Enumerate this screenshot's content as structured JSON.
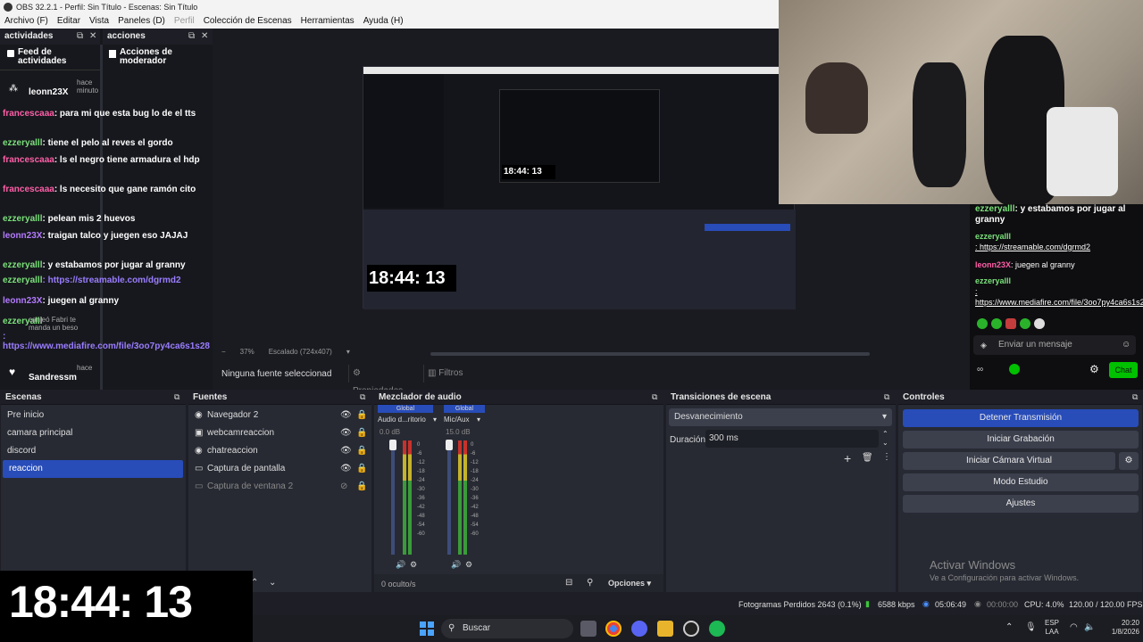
{
  "window": {
    "title": "OBS 32.2.1 - Perfil: Sin Título - Escenas: Sin Título"
  },
  "menu": [
    "Archivo (F)",
    "Editar",
    "Vista",
    "Paneles (D)",
    "Perfil",
    "Colección de Escenas",
    "Herramientas",
    "Ayuda (H)"
  ],
  "docks": {
    "activity": {
      "title": "actividades",
      "feed_label": "Feed de actividades"
    },
    "actions": {
      "title": "acciones",
      "mod_label": "Acciones de moderador"
    }
  },
  "chat_left": {
    "first_user": "leonn23X",
    "first_time": "hace minuto",
    "lines": [
      {
        "user": "francescaaa",
        "text": ": para mi que esta bug lo de el tts"
      },
      {
        "user": "ezzeryalll",
        "text": ": tiene el pelo al reves el gordo"
      },
      {
        "user": "francescaaa",
        "text": ": ls el negro tiene armadura el hdp"
      },
      {
        "user": "francescaaa",
        "text": ": ls necesito que gane ramón cito"
      },
      {
        "user": "ezzeryalll",
        "text": ": pelean mis 2 huevos"
      },
      {
        "user": "leonn23X",
        "text": ": traigan talco y juegen eso JAJAJ"
      },
      {
        "user": "ezzeryalll",
        "text": ": y estabamos por jugar al granny"
      },
      {
        "user": "ezzeryalll",
        "text": ": https://streamable.com/dgrmd2"
      },
      {
        "user": "leonn23X",
        "text": ": juegen al granny"
      },
      {
        "user": "ezzeryalll",
        "text": ": https://www.mediafire.com/file/3oo7py4ca6s1s28"
      }
    ],
    "sub_note": "canjeó Fabri te manda un beso",
    "last_user": "Sandressm",
    "last_time": "hace"
  },
  "preview": {
    "clock_large": "18:44: 13",
    "clock_small": "18:44: 13",
    "zoom": "37%",
    "scale_label": "Escalado (724x407)",
    "no_source": "Ninguna fuente seleccionad",
    "properties_btn": "Propiedades",
    "filters_btn": "Filtros"
  },
  "chat_right": {
    "lines": [
      {
        "user": "ezzeryalll",
        "text": ": y estabamos por jugar al granny"
      },
      {
        "user": "ezzeryalll",
        "text": ": https://streamable.com/dgrmd2"
      },
      {
        "user": "leonn23X",
        "text": ": juegen al granny"
      },
      {
        "user": "ezzeryalll",
        "text": ": https://www.mediafire.com/file/3oo7py4ca6s1s28"
      }
    ],
    "input_placeholder": "Enviar un mensaje",
    "chat_button": "Chat"
  },
  "scenes": {
    "title": "Escenas",
    "items": [
      "Pre inicio",
      "camara principal",
      "discord",
      "reaccion"
    ],
    "selected": "reaccion"
  },
  "sources": {
    "title": "Fuentes",
    "items": [
      "Navegador 2",
      "webcamreaccion",
      "chatreaccion",
      "Captura de pantalla",
      "Captura de ventana 2"
    ]
  },
  "mixer": {
    "title": "Mezclador de audio",
    "channels": [
      {
        "tag": "Global",
        "name": "Audio d...ritorio",
        "db": "0.0 dB"
      },
      {
        "tag": "Global",
        "name": "Mic/Aux",
        "db": "15.0 dB"
      }
    ],
    "scale": [
      "0",
      "-6",
      "-12",
      "-18",
      "-24",
      "-30",
      "-36",
      "-42",
      "-48",
      "-54",
      "-60"
    ],
    "hidden": "0 oculto/s",
    "options": "Opciones"
  },
  "transitions": {
    "title": "Transiciones de escena",
    "selected": "Desvanecimiento",
    "duration_label": "Duración",
    "duration_value": "300 ms"
  },
  "controls": {
    "title": "Controles",
    "buttons": [
      "Detener Transmisión",
      "Iniciar Grabación",
      "Iniciar Cámara Virtual",
      "Modo Estudio",
      "Ajustes"
    ]
  },
  "activate": {
    "title": "Activar Windows",
    "subtitle": "Ve a Configuración para activar Windows."
  },
  "statusbar": {
    "dropped": "Fotogramas Perdidos 2643 (0.1%)",
    "bitrate": "6588 kbps",
    "stream_time": "05:06:49",
    "rec_time": "00:00:00",
    "cpu": "CPU: 4.0%",
    "fps": "120.00 / 120.00 FPS"
  },
  "taskbar": {
    "search": "Buscar",
    "lang": "ESP",
    "lang2": "LAA",
    "time": "20:20",
    "date": "1/8/2026"
  },
  "colors": {
    "accent": "#284cb8",
    "panel": "#272a33",
    "base": "#1e1f26",
    "chat_green": "#00c000"
  }
}
